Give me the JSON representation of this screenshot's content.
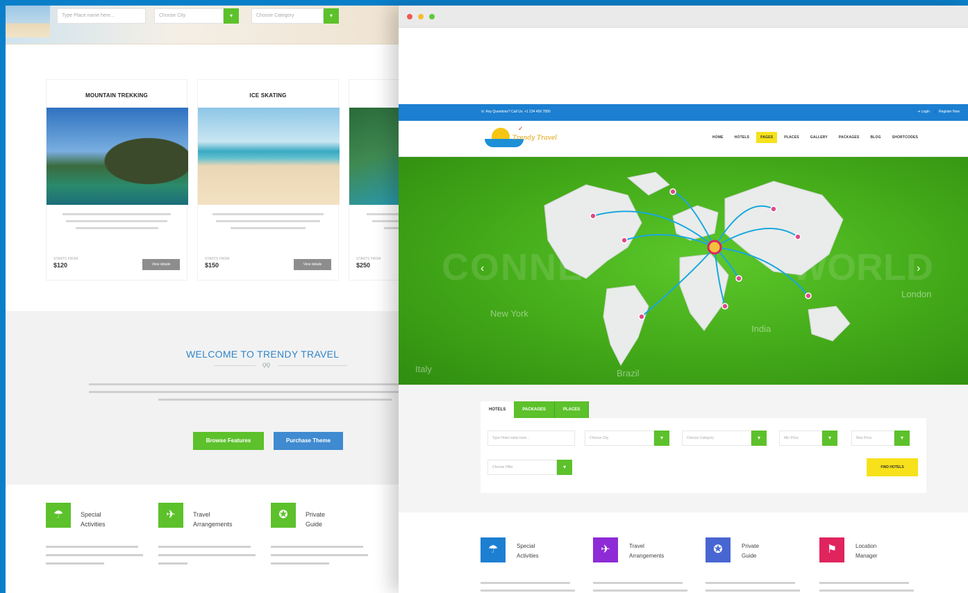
{
  "back": {
    "top_search": {
      "keyword_placeholder": "Type Place name here...",
      "city_placeholder": "Choose City",
      "category_placeholder": "Choose Category",
      "dropdown_glyph": "▾"
    },
    "cards": [
      {
        "title": "MOUNTAIN TREKKING",
        "price_label": "STARTS FROM",
        "price": "$120",
        "button": "View details",
        "image": "mountain-island-photo"
      },
      {
        "title": "ICE SKATING",
        "price_label": "STARTS FROM",
        "price": "$150",
        "button": "View details",
        "image": "beach-starfish-photo"
      },
      {
        "title": "",
        "price_label": "STARTS FROM",
        "price": "$250",
        "button": "View details",
        "image": "waterfall-photo"
      }
    ],
    "welcome": {
      "title": "WELCOME TO TRENDY TRAVEL",
      "ornament": "ǫǫ",
      "browse_button": "Browse Features",
      "purchase_button": "Purchase Theme"
    },
    "features": [
      {
        "title": "Special\nActivities",
        "icon": "parachute-icon",
        "glyph": "☂"
      },
      {
        "title": "Travel\nArrangements",
        "icon": "plane-icon",
        "glyph": "✈"
      },
      {
        "title": "Private\nGuide",
        "icon": "compass-icon",
        "glyph": "✪"
      }
    ]
  },
  "front": {
    "topbar": {
      "contact": "☏ Any Questions? Call Us: +1 234 456 7890",
      "login": "⇥ Login",
      "register": "👤 Register Now"
    },
    "logo": {
      "text": "Trendy Travel"
    },
    "nav": [
      "HOME",
      "HOTELS",
      "PAGES",
      "PLACES",
      "GALLERY",
      "PACKAGES",
      "BLOG",
      "SHORTCODES"
    ],
    "nav_active": "PAGES",
    "slider": {
      "headline_left": "CONNE",
      "headline_right": "WORLD",
      "cities": [
        "New York",
        "Italy",
        "Brazil",
        "India",
        "London"
      ],
      "prev": "‹",
      "next": "›"
    },
    "search": {
      "tabs": [
        "HOTELS",
        "PACKAGES",
        "PLACES"
      ],
      "fields": {
        "name": "Type Hotel name here...",
        "city": "Choose City",
        "category": "Choose Category",
        "min_price": "Min Price",
        "max_price": "Max Price",
        "offer": "Choose Offer"
      },
      "find_button": "FIND HOTELS"
    },
    "features": [
      {
        "title": "Special\nActivities",
        "icon": "parachute-icon",
        "color": "#1c7fd1",
        "glyph": "☂"
      },
      {
        "title": "Travel\nArrangements",
        "icon": "plane-icon",
        "color": "#8e2bd6",
        "glyph": "✈"
      },
      {
        "title": "Private\nGuide",
        "icon": "compass-icon",
        "color": "#4866d2",
        "glyph": "✪"
      },
      {
        "title": "Location\nManager",
        "icon": "map-pin-icon",
        "color": "#e0245e",
        "glyph": "⚑"
      }
    ]
  },
  "colors": {
    "page_bg": "#0a7fc9",
    "green": "#5cc12b",
    "blue": "#1c7fd1",
    "yellow": "#f7e11b"
  }
}
